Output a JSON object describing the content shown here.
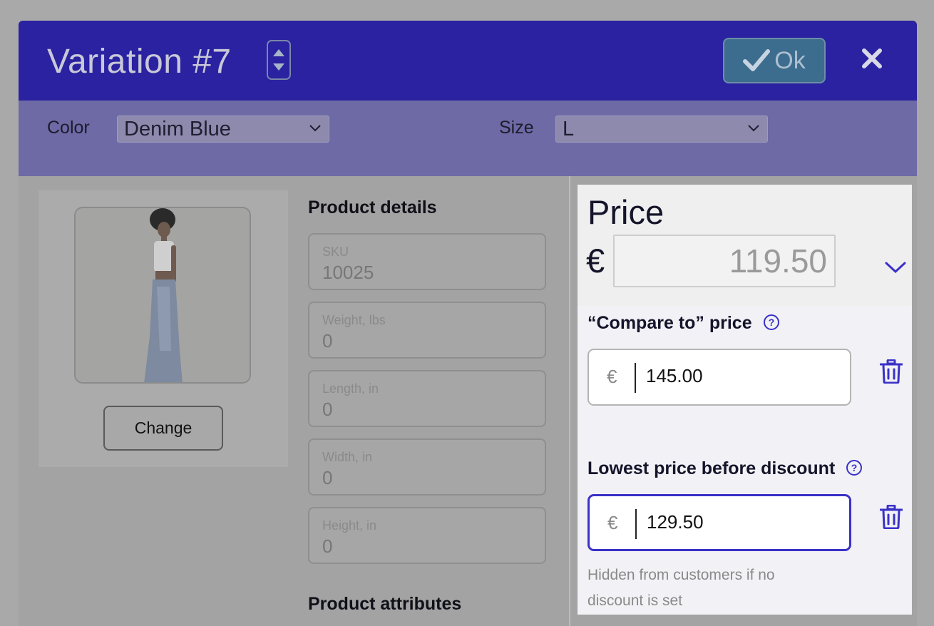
{
  "dialog": {
    "title": "Variation #7",
    "ok_label": "Ok"
  },
  "attributes": {
    "color_label": "Color",
    "color_value": "Denim Blue",
    "size_label": "Size",
    "size_value": "L"
  },
  "image": {
    "change_label": "Change"
  },
  "product_details": {
    "title": "Product details",
    "fields": [
      {
        "label": "SKU",
        "value": "10025"
      },
      {
        "label": "Weight, lbs",
        "value": "0"
      },
      {
        "label": "Length, in",
        "value": "0"
      },
      {
        "label": "Width, in",
        "value": "0"
      },
      {
        "label": "Height, in",
        "value": "0"
      }
    ]
  },
  "product_attributes": {
    "title": "Product attributes"
  },
  "price": {
    "title": "Price",
    "currency": "€",
    "value": "119.50",
    "compare_label": "“Compare to” price",
    "compare_currency": "€",
    "compare_value": "145.00",
    "lowest_label": "Lowest price before discount",
    "lowest_currency": "€",
    "lowest_value": "129.50",
    "lowest_hint": "Hidden from customers if no discount is set"
  },
  "colors": {
    "header": "#2a22a0",
    "attribute_bar": "#6d6aa6",
    "accent": "#3a31c8"
  },
  "icons": [
    "stepper-icon",
    "checkmark-icon",
    "close-icon",
    "chevron-down-icon",
    "help-icon",
    "trash-icon"
  ]
}
